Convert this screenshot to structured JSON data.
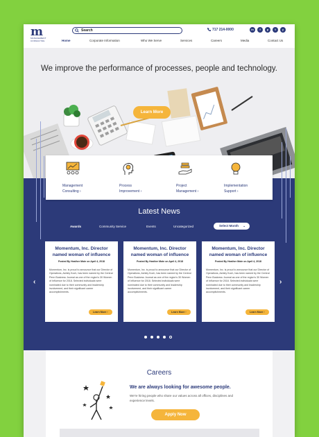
{
  "header": {
    "logo_mark": "m",
    "logo_text": "MANAGEMENT CONSULTING",
    "search_label": "Search",
    "phone": "717 214-0000",
    "socials": [
      "in",
      "f",
      "p",
      "t",
      "y"
    ]
  },
  "nav": [
    "Home",
    "Corporate Information",
    "Who We Serve",
    "Services",
    "Careers",
    "Media",
    "Contact Us"
  ],
  "hero": {
    "title": "We improve the performance of processes, people and technology.",
    "button": "Learn More"
  },
  "services": [
    {
      "icon": "presentation-chart-icon",
      "label": "Management Consulting ›"
    },
    {
      "icon": "head-gears-icon",
      "label": "Process Improvement ›"
    },
    {
      "icon": "hand-stack-icon",
      "label": "Project Management ›"
    },
    {
      "icon": "lightbulb-icon",
      "label": "Implementation Support ›"
    }
  ],
  "news": {
    "title": "Latest News",
    "tabs": [
      "Awards",
      "Community Service",
      "Events",
      "Uncategorized"
    ],
    "select": "Select Month",
    "cards": [
      {
        "title": "Momentum, Inc. Director named woman of influence",
        "meta": "Posted By Heather Mote on April 4, 2018",
        "body": "Momentum, Inc. is proud to announce that our Director of Operations, Ashley Koch, has been named by the Central Penn Business Journal as one of the region's 30 Women of Influence for 2018. Selected individuals were nominated due to their community and leadership involvement, and their significant career accomplishments.",
        "button": "Learn More"
      },
      {
        "title": "Momentum, Inc. Director named woman of influence",
        "meta": "Posted By Heather Mote on April 4, 2018",
        "body": "Momentum, Inc. is proud to announce that our Director of Operations, Ashley Koch, has been named by the Central Penn Business Journal as one of the region's 30 Women of Influence for 2018. Selected individuals were nominated due to their community and leadership involvement, and their significant career accomplishments.",
        "button": "Learn More"
      },
      {
        "title": "Momentum, Inc. Director named woman of influence",
        "meta": "Posted By Heather Mote on April 4, 2018",
        "body": "Momentum, Inc. is proud to announce that our Director of Operations, Ashley Koch, has been named by the Central Penn Business Journal as one of the region's 30 Women of Influence for 2018. Selected individuals were nominated due to their community and leadership involvement, and their significant career accomplishments.",
        "button": "Learn More"
      }
    ],
    "prev": "‹",
    "next": "›"
  },
  "careers": {
    "title": "Careers",
    "subtitle": "We are always looking for awesome people.",
    "text": "We're hiring people who share our values across all offices, disciplines and experience levels.",
    "button": "Apply Now"
  },
  "colors": {
    "brand": "#2c3a79",
    "accent": "#f5b53b",
    "background": "#82d13f"
  }
}
